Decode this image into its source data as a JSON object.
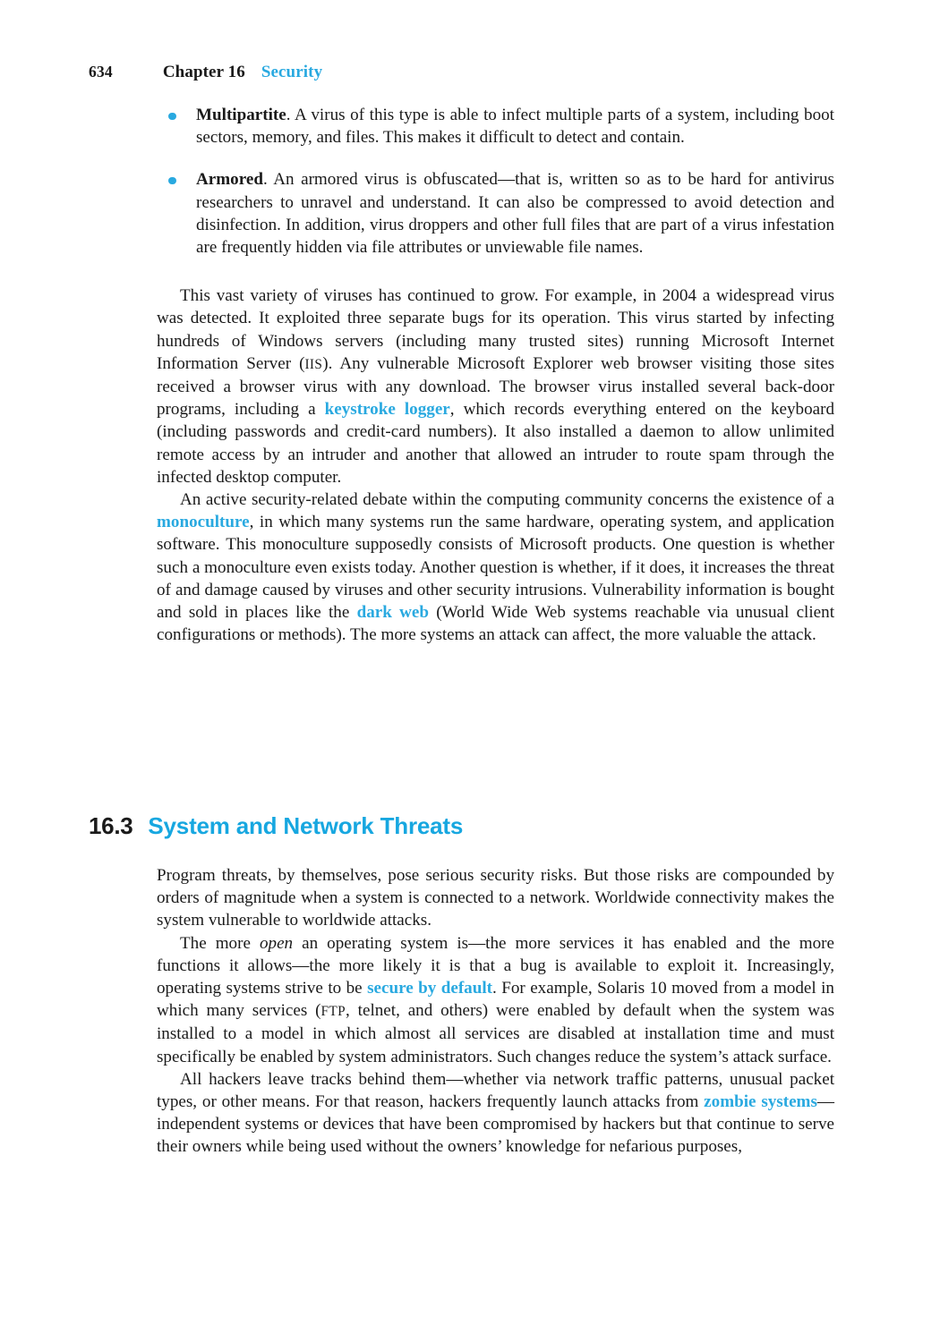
{
  "page": {
    "folio": "634",
    "chapter_label": "Chapter 16",
    "chapter_title": "Security",
    "accent_color": "#29a9e0",
    "heading_color": "#17a7e0",
    "text_color": "#1a1a1a",
    "background": "#ffffff"
  },
  "bullets": [
    {
      "term": "Multipartite",
      "text": ". A virus of this type is able to infect multiple parts of a system, including boot sectors, memory, and files. This makes it difficult to detect and contain."
    },
    {
      "term": "Armored",
      "text": ". An armored virus is obfuscated—that is, written so as to be hard for antivirus researchers to unravel and understand. It can also be compressed to avoid detection and disinfection. In addition, virus droppers and other full files that are part of a virus infestation are frequently hidden via file attributes or unviewable file names."
    }
  ],
  "paragraphs": {
    "p1_a": "This vast variety of viruses has continued to grow. For example, in 2004 a widespread virus was detected. It exploited three separate bugs for its operation. This virus started by infecting hundreds of Windows servers (including many trusted sites) running Microsoft Internet Information Server (",
    "p1_iis": "IIS",
    "p1_b": "). Any vulnerable Microsoft Explorer web browser visiting those sites received a browser virus with any download. The browser virus installed several back-door programs, including a ",
    "p1_kw": "keystroke logger",
    "p1_c": ", which records everything entered on the keyboard (including passwords and credit-card numbers). It also installed a daemon to allow unlimited remote access by an intruder and another that allowed an intruder to route spam through the infected desktop computer.",
    "p2_a": "An active security-related debate within the computing community concerns the existence of a ",
    "p2_kw1": "monoculture",
    "p2_b": ", in which many systems run the same hardware, operating system, and application software. This monoculture supposedly consists of Microsoft products. One question is whether such a monoculture even exists today. Another question is whether, if it does, it increases the threat of and damage caused by viruses and other security intrusions. Vulnerability information is bought and sold in places like the ",
    "p2_kw2": "dark web",
    "p2_c": " (World Wide Web systems reachable via unusual client configurations or methods). The more systems an attack can affect, the more valuable the attack.",
    "p3": "Program threats, by themselves, pose serious security risks. But those risks are compounded by orders of magnitude when a system is connected to a network. Worldwide connectivity makes the system vulnerable to worldwide attacks.",
    "p4_a": "The more ",
    "p4_ital": "open",
    "p4_b": " an operating system is—the more services it has enabled and the more functions it allows—the more likely it is that a bug is available to exploit it. Increasingly, operating systems strive to be ",
    "p4_kw": "secure by default",
    "p4_c": ". For example, Solaris 10 moved from a model in which many services (",
    "p4_ftp": "FTP",
    "p4_d": ", telnet, and others) were enabled by default when the system was installed to a model in which almost all services are disabled at installation time and must specifically be enabled by system administrators. Such changes reduce the system’s attack surface.",
    "p5_a": "All hackers leave tracks behind them—whether via network traffic patterns, unusual packet types, or other means. For that reason, hackers frequently launch attacks from ",
    "p5_kw": "zombie systems",
    "p5_b": "—independent systems or devices that have been compromised by hackers but that continue to serve their owners while being used without the owners’ knowledge for nefarious purposes,"
  },
  "section": {
    "number": "16.3",
    "title": "System and Network Threats"
  }
}
